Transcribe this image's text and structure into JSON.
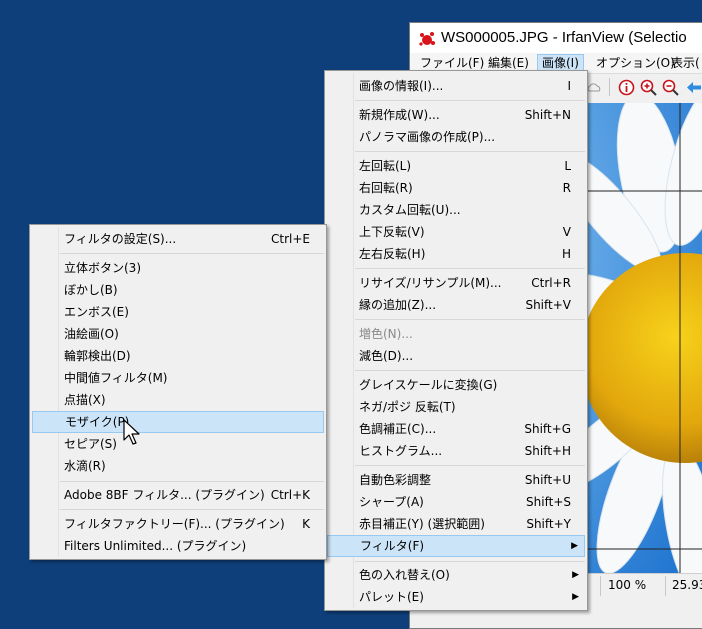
{
  "window": {
    "title": "WS000005.JPG - IrfanView (Selectio",
    "menubar": [
      "ファイル(F)",
      "編集(E)",
      "画像(I)",
      "オプション(O)",
      "表示("
    ],
    "active_menu_index": 2,
    "status": {
      "zoom": "100 %",
      "extra": "25.93"
    }
  },
  "image_menu": {
    "items": [
      {
        "label": "画像の情報(I)...",
        "shortcut": "I"
      },
      {
        "label": "新規作成(W)...",
        "shortcut": "Shift+N"
      },
      {
        "label": "パノラマ画像の作成(P)...",
        "shortcut": ""
      },
      {
        "label": "左回転(L)",
        "shortcut": "L"
      },
      {
        "label": "右回転(R)",
        "shortcut": "R"
      },
      {
        "label": "カスタム回転(U)...",
        "shortcut": ""
      },
      {
        "label": "上下反転(V)",
        "shortcut": "V"
      },
      {
        "label": "左右反転(H)",
        "shortcut": "H"
      },
      {
        "label": "リサイズ/リサンプル(M)...",
        "shortcut": "Ctrl+R"
      },
      {
        "label": "縁の追加(Z)...",
        "shortcut": "Shift+V"
      },
      {
        "label": "増色(N)...",
        "shortcut": ""
      },
      {
        "label": "減色(D)...",
        "shortcut": ""
      },
      {
        "label": "グレイスケールに変換(G)",
        "shortcut": ""
      },
      {
        "label": "ネガ/ポジ 反転(T)",
        "shortcut": ""
      },
      {
        "label": "色調補正(C)...",
        "shortcut": "Shift+G"
      },
      {
        "label": "ヒストグラム...",
        "shortcut": "Shift+H"
      },
      {
        "label": "自動色彩調整",
        "shortcut": "Shift+U"
      },
      {
        "label": "シャープ(A)",
        "shortcut": "Shift+S"
      },
      {
        "label": "赤目補正(Y) (選択範囲)",
        "shortcut": "Shift+Y"
      },
      {
        "label": "フィルタ(F)",
        "shortcut": ""
      },
      {
        "label": "色の入れ替え(O)",
        "shortcut": ""
      },
      {
        "label": "パレット(E)",
        "shortcut": ""
      }
    ]
  },
  "filter_menu": {
    "items": [
      {
        "label": "フィルタの設定(S)...",
        "shortcut": "Ctrl+E"
      },
      {
        "label": "立体ボタン(3)",
        "shortcut": ""
      },
      {
        "label": "ぼかし(B)",
        "shortcut": ""
      },
      {
        "label": "エンボス(E)",
        "shortcut": ""
      },
      {
        "label": "油絵画(O)",
        "shortcut": ""
      },
      {
        "label": "輪郭検出(D)",
        "shortcut": ""
      },
      {
        "label": "中間値フィルタ(M)",
        "shortcut": ""
      },
      {
        "label": "点描(X)",
        "shortcut": ""
      },
      {
        "label": "モザイク(P)",
        "shortcut": ""
      },
      {
        "label": "セピア(S)",
        "shortcut": ""
      },
      {
        "label": "水滴(R)",
        "shortcut": ""
      },
      {
        "label": "Adobe 8BF フィルタ... (プラグイン)",
        "shortcut": "Ctrl+K"
      },
      {
        "label": "フィルタファクトリー(F)... (プラグイン)",
        "shortcut": "K"
      },
      {
        "label": "Filters Unlimited... (プラグイン)",
        "shortcut": ""
      }
    ]
  },
  "colors": {
    "desktop": "#0e3f7a",
    "highlight": "#cce4f7",
    "highlight_border": "#99c9ef"
  }
}
